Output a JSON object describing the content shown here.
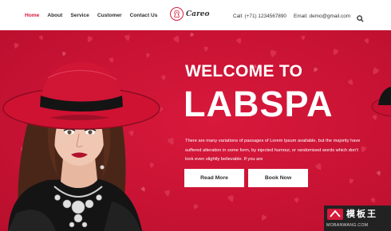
{
  "nav": {
    "items": [
      {
        "label": "Home",
        "active": true
      },
      {
        "label": "About",
        "active": false
      },
      {
        "label": "Service",
        "active": false
      },
      {
        "label": "Customer",
        "active": false
      },
      {
        "label": "Contact Us",
        "active": false
      }
    ]
  },
  "brand": {
    "name": "Careo",
    "icon": "woman-silhouette-icon"
  },
  "contact": {
    "phone": "Call: (+71) 1234567890",
    "email": "Email: demo@gmail.com",
    "search_icon": "search-icon"
  },
  "hero": {
    "title_line1": "WELCOME TO",
    "title_line2": "LABSPA",
    "description": "There are many variations of passages of Lorem Ipsum available, but the majority have suffered alteration in some form, by injected humour, or randomised words which don't look even slightly believable. If you are",
    "read_more_label": "Read More",
    "book_now_label": "Book Now",
    "background_color": "#cd1436",
    "accent_color": "#d61a3c"
  },
  "watermark": {
    "title": "模板王",
    "url": "MOBANWANG.COM"
  }
}
